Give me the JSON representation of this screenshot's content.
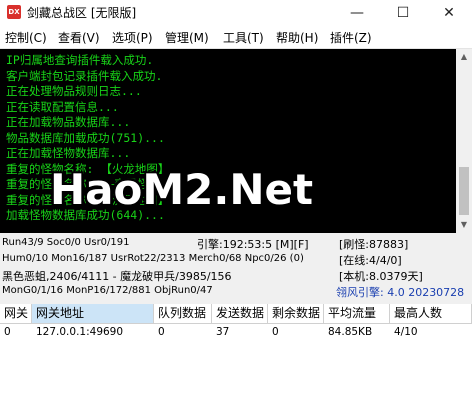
{
  "window": {
    "title": "剑藏总战区 [无限版]",
    "icon_text": "DX",
    "controls": [
      "—",
      "☐",
      "✕"
    ]
  },
  "menu": [
    {
      "label": "控制(C)"
    },
    {
      "label": "查看(V)"
    },
    {
      "label": "选项(P)"
    },
    {
      "label": "管理(M)"
    },
    {
      "label": "工具(T)"
    },
    {
      "label": "帮助(H)"
    },
    {
      "label": "插件(Z)"
    }
  ],
  "console": {
    "lines": [
      "IP归属地查询插件载入成功.",
      "客户端封包记录插件载入成功.",
      "正在处理物品规则日志...",
      "正在读取配置信息...",
      "正在加载物品数据库...",
      "物品数据库加载成功(751)...",
      "正在加载怪物数据库...",
      "重复的怪物名称: 【火龙地图】",
      "重复的怪物名称: ——变异怪物——",
      "重复的怪物名称: 【沃玛地图】",
      "加载怪物数据库成功(644)..."
    ],
    "text_color": "#18d418",
    "background": "#000000"
  },
  "watermark": "HaoM2.Net",
  "status": {
    "r1_left": "Run43/9 Soc0/0 Usr0/191",
    "r1_mid": "引擎:192:53:5 [M][F]",
    "r1_right": "[刷怪:87883]",
    "r2_left": "Hum0/10 Mon16/187 UsrRot22/2313 Merch0/68 Npc0/26 (0)",
    "r2_right": "[在线:4/4/0]",
    "r3_left": "黑色恶蛆,2406/4111 - 魔龙破甲兵/3985/156",
    "r3_right": "[本机:8.0379天]",
    "r4_left": "MonG0/1/16 MonP16/172/881 ObjRun0/47",
    "r4_right": "翎风引擎: 4.0 20230728"
  },
  "grid": {
    "columns": [
      "网关",
      "网关地址",
      "队列数据",
      "发送数据",
      "剩余数据",
      "平均流量",
      "最高人数"
    ],
    "rows": [
      [
        "0",
        "127.0.0.1:49690",
        "0",
        "37",
        "0",
        "84.85KB",
        "4/10"
      ]
    ]
  }
}
